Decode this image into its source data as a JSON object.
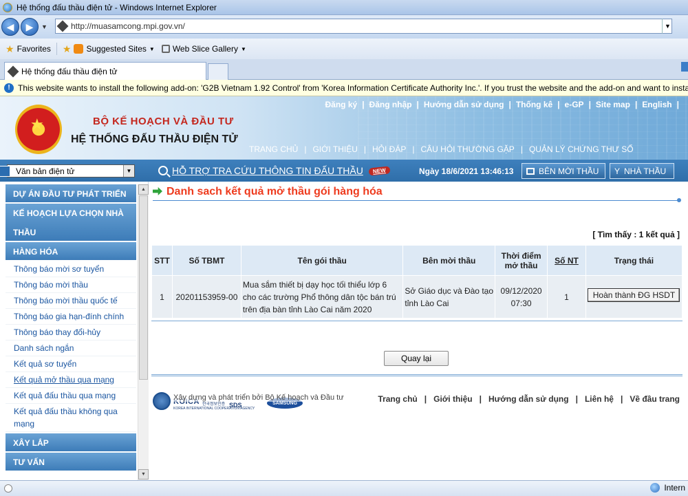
{
  "window": {
    "title": "Hệ thống đấu thầu điện tử - Windows Internet Explorer",
    "url": "http://muasamcong.mpi.gov.vn/"
  },
  "favorites": {
    "favorites_label": "Favorites",
    "suggested_sites": "Suggested Sites",
    "web_slice_gallery": "Web Slice Gallery"
  },
  "tab": {
    "title": "Hệ thống đấu thầu điện tử"
  },
  "infobar": {
    "text": "This website wants to install the following add-on: 'G2B Vietnam 1.92 Control' from 'Korea Information Certificate Authority Inc.'. If you trust the website and the add-on and want to install"
  },
  "header": {
    "ministry": "BỘ KẾ HOẠCH VÀ ĐẦU TƯ",
    "system": "HỆ THỐNG ĐẤU THẦU ĐIỆN TỬ",
    "top_links": [
      "Đăng ký",
      "Đăng nhập",
      "Hướng dẫn sử dụng",
      "Thống kê",
      "e-GP",
      "Site map",
      "English"
    ],
    "main_nav": [
      "TRANG CHỦ",
      "GIỚI THIỆU",
      "HỎI ĐÁP",
      "CÂU HỎI THƯỜNG GẶP",
      "QUẢN LÝ CHỨNG THƯ SỐ"
    ]
  },
  "subbar": {
    "doc_select_value": "Văn bản điện tử",
    "support_link": "HỖ TRỢ TRA CỨU THÔNG TIN ĐẤU THẦU",
    "new_badge": "NEW",
    "datetime": "Ngày 18/6/2021 13:46:13",
    "btn_ben_moi_thau": "BÊN MỜI THẦU",
    "btn_nha_thau": "NHÀ THẦU"
  },
  "sidebar": {
    "head_du_an": "DỰ ÁN ĐẦU TƯ PHÁT TRIỂN",
    "head_ke_hoach": "KẾ HOẠCH LỰA CHỌN NHÀ THẦU",
    "head_hang_hoa": "HÀNG HÓA",
    "items": [
      "Thông báo mời sơ tuyển",
      "Thông báo mời thầu",
      "Thông báo mời thầu quốc tế",
      "Thông báo gia hạn-đính chính",
      "Thông báo thay đổi-hủy",
      "Danh sách ngắn",
      "Kết quả sơ tuyển",
      "Kết quả mở thầu qua mạng",
      "Kết quả đấu thầu qua mạng",
      "Kết quả đấu thầu không qua mạng"
    ],
    "head_xay_lap": "XÂY LẮP",
    "head_tu_van": "TƯ VẤN"
  },
  "main": {
    "title": "Danh sach kết quả mở thầu gói hàng hóa",
    "found": "[ Tìm thấy : 1 kết quả ]",
    "columns": {
      "stt": "STT",
      "so_tbmt": "Số TBMT",
      "ten_goi_thau": "Tên gói thầu",
      "ben_moi_thau": "Bên mời thầu",
      "thoi_diem": "Thời điểm mở thầu",
      "so_nt": "Số NT",
      "trang_thai": "Trạng thái"
    },
    "rows": [
      {
        "stt": "1",
        "so_tbmt": "20201153959-00",
        "ten_goi_thau": "Mua sắm thiết bị dạy học tối thiểu lớp 6 cho các trường Phổ thông dân tộc bán trú trên địa bàn tỉnh Lào Cai năm 2020",
        "ben_moi_thau": "Sở Giáo dục và Đào tạo tỉnh Lào Cai",
        "thoi_diem_date": "09/12/2020",
        "thoi_diem_time": "07:30",
        "so_nt": "1",
        "trang_thai": "Hoàn thành ĐG HSDT"
      }
    ],
    "back_button": "Quay lại"
  },
  "footer": {
    "koica": "KOICA",
    "koica_sub": "KOREA INTERNATIONAL COOPERATION AGENCY",
    "logo_kr": "한국정보인증",
    "logo_sds": "SDS",
    "samsung": "SAMSUNG",
    "built_by": "Xây dựng và phát triển bởi Bộ Kế hoạch và Đầu tư",
    "links": [
      "Trang chủ",
      "Giới thiệu",
      "Hướng dẫn sử dụng",
      "Liên hệ",
      "Về đầu trang"
    ]
  },
  "statusbar": {
    "zone": "Intern"
  }
}
